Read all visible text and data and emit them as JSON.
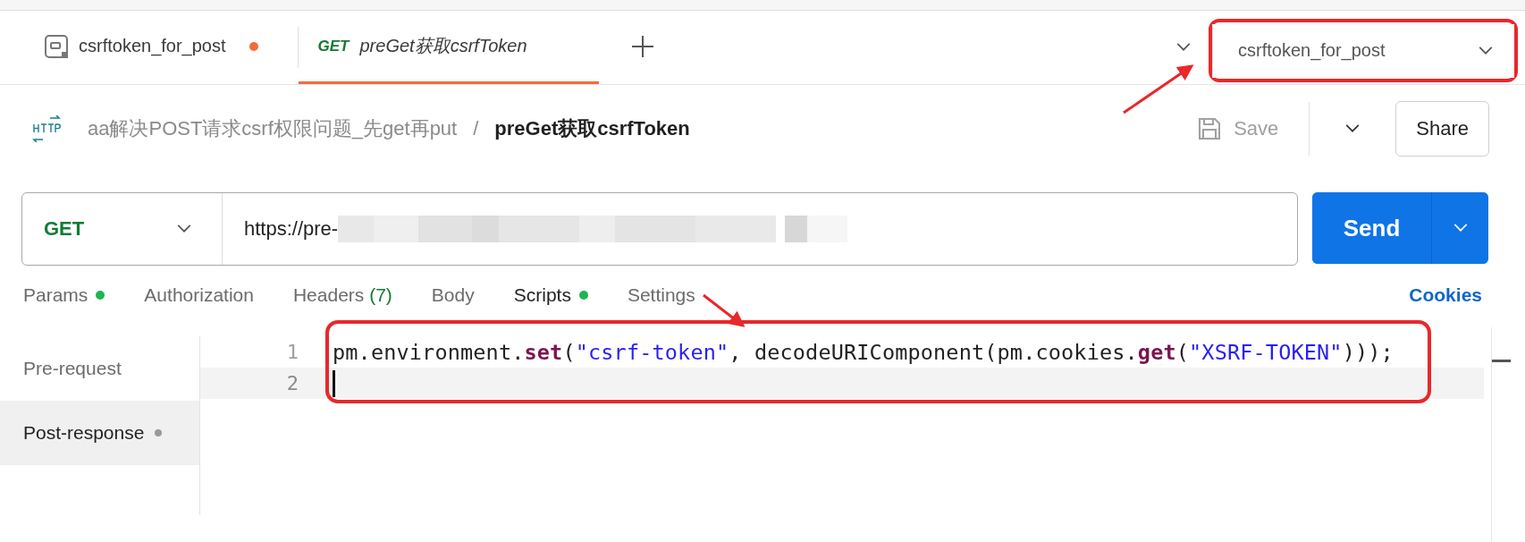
{
  "tabs": [
    {
      "kind": "example",
      "label": "csrftoken_for_post",
      "modified": true,
      "preview": false,
      "selected": false
    },
    {
      "kind": "request",
      "method": "GET",
      "label": "preGet获取csrfToken",
      "modified": false,
      "preview": true,
      "selected": true
    }
  ],
  "environment": {
    "value": "csrftoken_for_post",
    "highlighted": true,
    "arrow": true
  },
  "breadcrumb": {
    "collection": "aa解决POST请求csrf权限问题_先get再put",
    "separator": "/",
    "request": "preGet获取csrfToken"
  },
  "actions": {
    "save": "Save",
    "save_disabled": true,
    "share": "Share"
  },
  "request": {
    "method": "GET",
    "url": "https://pre-",
    "url_blurred": true,
    "send": "Send"
  },
  "request_tabs": [
    {
      "label": "Params",
      "indicator": true,
      "selected": false
    },
    {
      "label": "Authorization",
      "indicator": false,
      "selected": false
    },
    {
      "label": "Headers",
      "count": "(7)",
      "indicator": false,
      "selected": false
    },
    {
      "label": "Body",
      "indicator": false,
      "selected": false
    },
    {
      "label": "Scripts",
      "indicator": true,
      "selected": true
    },
    {
      "label": "Settings",
      "indicator": false,
      "selected": false
    }
  ],
  "cookies_link": "Cookies",
  "script_sidebar": [
    {
      "label": "Pre-request",
      "indicator": false,
      "selected": false
    },
    {
      "label": "Post-response",
      "indicator": true,
      "selected": true
    }
  ],
  "editor": {
    "highlighted": true,
    "arrow": true,
    "lines": [
      {
        "number": "1",
        "current": false,
        "tokens": [
          {
            "kind": "plain",
            "text": "pm.environment."
          },
          {
            "kind": "method",
            "text": "set"
          },
          {
            "kind": "plain",
            "text": "("
          },
          {
            "kind": "string",
            "text": "\"csrf-token\""
          },
          {
            "kind": "plain",
            "text": ", decodeURIComponent(pm.cookies."
          },
          {
            "kind": "method",
            "text": "get"
          },
          {
            "kind": "plain",
            "text": "("
          },
          {
            "kind": "string",
            "text": "\"XSRF-TOKEN\""
          },
          {
            "kind": "plain",
            "text": ")));"
          }
        ]
      },
      {
        "number": "2",
        "current": true
      }
    ]
  }
}
